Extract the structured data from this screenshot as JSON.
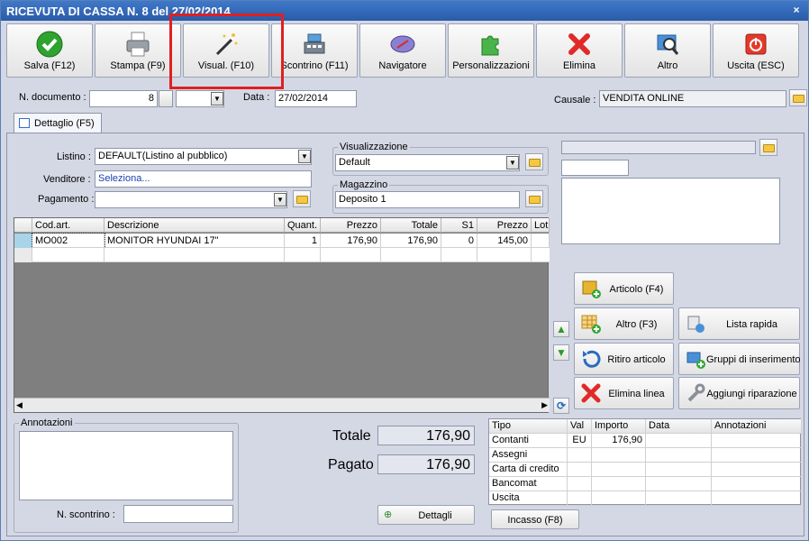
{
  "window": {
    "title": "RICEVUTA DI CASSA N. 8 del 27/02/2014",
    "close": "×"
  },
  "toolbar": [
    {
      "label": "Salva (F12)",
      "icon": "check-icon"
    },
    {
      "label": "Stampa (F9)",
      "icon": "printer-icon"
    },
    {
      "label": "Visual. (F10)",
      "icon": "magic-wand-icon"
    },
    {
      "label": "Scontrino (F11)",
      "icon": "cash-register-icon"
    },
    {
      "label": "Navigatore",
      "icon": "compass-icon"
    },
    {
      "label": "Personalizzazioni",
      "icon": "puzzle-icon"
    },
    {
      "label": "Elimina",
      "icon": "delete-x-icon"
    },
    {
      "label": "Altro",
      "icon": "search-icon"
    },
    {
      "label": "Uscita (ESC)",
      "icon": "power-icon"
    }
  ],
  "header": {
    "doc_label": "N. documento :",
    "doc_value": "8",
    "data_label": "Data :",
    "data_value": "27/02/2014",
    "causale_label": "Causale :",
    "causale_value": "VENDITA ONLINE"
  },
  "tab": {
    "label": "Dettaglio (F5)"
  },
  "form": {
    "listino_label": "Listino :",
    "listino_value": "DEFAULT(Listino al pubblico)",
    "venditore_label": "Venditore :",
    "venditore_value": "Seleziona...",
    "pagamento_label": "Pagamento :",
    "pagamento_value": "",
    "visual_label": "Visualizzazione",
    "visual_value": "Default",
    "magazzino_label": "Magazzino",
    "magazzino_value": "Deposito 1"
  },
  "grid": {
    "columns": [
      "Cod.art.",
      "Descrizione",
      "Quant.",
      "Prezzo",
      "Totale",
      "S1",
      "Prezzo",
      "Lot"
    ],
    "rows": [
      [
        "MO002",
        "MONITOR HYUNDAI 17\"",
        "1",
        "176,90",
        "176,90",
        "0",
        "145,00",
        ""
      ]
    ]
  },
  "actions": {
    "articolo": "Articolo (F4)",
    "altro": "Altro (F3)",
    "lista_rapida": "Lista rapida",
    "ritiro": "Ritiro articolo",
    "gruppi": "Gruppi di inserimento",
    "elimina_linea": "Elimina linea",
    "aggiungi_riparazione": "Aggiungi riparazione"
  },
  "notes": {
    "title": "Annotazioni",
    "scontrino_label": "N. scontrino :"
  },
  "totals": {
    "totale_label": "Totale",
    "totale_value": "176,90",
    "pagato_label": "Pagato",
    "pagato_value": "176,90",
    "dettagli": "Dettagli"
  },
  "payments": {
    "columns": [
      "Tipo",
      "Val",
      "Importo",
      "Data",
      "Annotazioni"
    ],
    "rows": [
      [
        "Contanti",
        "EU",
        "176,90",
        "",
        ""
      ],
      [
        "Assegni",
        "",
        "",
        "",
        ""
      ],
      [
        "Carta di credito",
        "",
        "",
        "",
        ""
      ],
      [
        "Bancomat",
        "",
        "",
        "",
        ""
      ],
      [
        "Uscita",
        "",
        "",
        "",
        ""
      ]
    ],
    "incasso": "Incasso (F8)"
  }
}
